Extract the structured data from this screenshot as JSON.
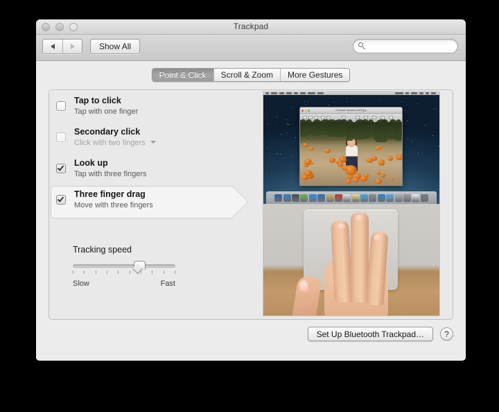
{
  "window": {
    "title": "Trackpad",
    "traffic_lights": [
      "close",
      "minimize",
      "zoom"
    ]
  },
  "toolbar": {
    "back_label": "◀",
    "forward_label": "▶",
    "show_all_label": "Show All",
    "search": {
      "icon": "search-icon",
      "value": "",
      "placeholder": ""
    }
  },
  "tabs": [
    {
      "label": "Point & Click",
      "active": true
    },
    {
      "label": "Scroll & Zoom",
      "active": false
    },
    {
      "label": "More Gestures",
      "active": false
    }
  ],
  "options": [
    {
      "title": "Tap to click",
      "subtitle": "Tap with one finger",
      "checked": false,
      "disabled": false,
      "selected": false,
      "has_popup": false
    },
    {
      "title": "Secondary click",
      "subtitle": "Click with two fingers",
      "checked": false,
      "disabled": true,
      "selected": false,
      "has_popup": true
    },
    {
      "title": "Look up",
      "subtitle": "Tap with three fingers",
      "checked": true,
      "disabled": false,
      "selected": false,
      "has_popup": false
    },
    {
      "title": "Three finger drag",
      "subtitle": "Move with three fingers",
      "checked": true,
      "disabled": false,
      "selected": true,
      "has_popup": false
    }
  ],
  "tracking_speed": {
    "label": "Tracking speed",
    "min_label": "Slow",
    "max_label": "Fast",
    "tick_count": 10,
    "value_percent": 65
  },
  "preview": {
    "name": "gesture-preview-video",
    "top_scene": "desktop-with-preview-window",
    "bottom_scene": "hand-three-fingers-on-trackpad",
    "preview_window_title": "Colorado Vacation 2009.jpg"
  },
  "bottom": {
    "setup_button_label": "Set Up Bluetooth Trackpad…",
    "help_button_label": "?"
  },
  "colors": {
    "window_bg": "#ececec",
    "panel_bg": "#e9e9e9",
    "selected_row_bg": "#f4f4f4",
    "tab_active_bg": "#9d9d9d",
    "check_mark": "#2e3a49"
  }
}
